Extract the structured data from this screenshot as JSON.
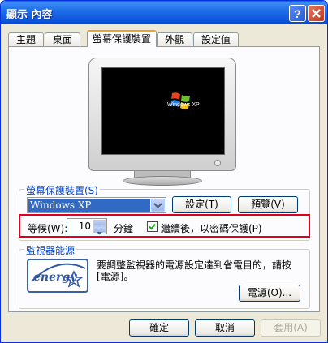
{
  "window": {
    "title": "顯示 內容"
  },
  "tabs": [
    "主題",
    "桌面",
    "螢幕保護裝置",
    "外觀",
    "設定值"
  ],
  "screensaver_group": {
    "label": "螢幕保護裝置(S)",
    "selected": "Windows XP",
    "settings_button": "設定(T)",
    "preview_button": "預覽(V)",
    "wait_label": "等候(W):",
    "wait_value": "10",
    "minutes_label": "分鐘",
    "resume_password_label": "繼續後，以密碼保護(P)",
    "resume_password_checked": true
  },
  "preview": {
    "logo_text": "Windows XP"
  },
  "power_group": {
    "label": "監視器能源",
    "description_line1": "要調整監視器的電源設定達到省電目的，請按",
    "description_line2": "[電源]。",
    "power_button": "電源(O)...",
    "logo_text": "energy"
  },
  "footer": {
    "ok": "確定",
    "cancel": "取消",
    "apply": "套用(A)"
  },
  "colors": {
    "titlebar": "#0a52d8",
    "accent_label": "#0046d5",
    "highlight_box": "#e0001b"
  }
}
